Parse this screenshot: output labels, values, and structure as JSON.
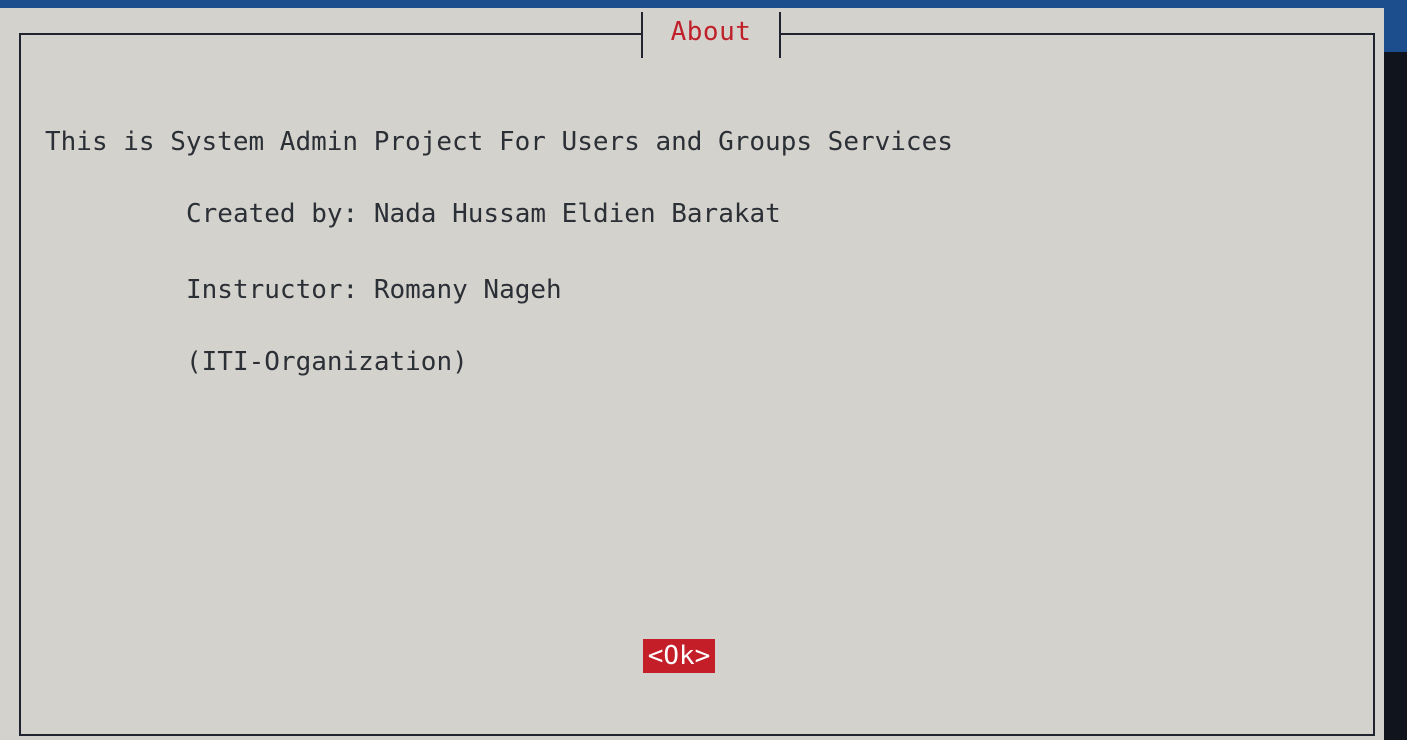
{
  "dialog": {
    "title": "About",
    "message_lines": [
      "This is System Admin Project For Users and Groups Services",
      "Created by: Nada Hussam Eldien Barakat",
      "Instructor: Romany Nageh",
      "(ITI-Organization)"
    ],
    "ok_label": "<Ok>"
  },
  "colors": {
    "dialog_background": "#d4d2cd",
    "title_color": "#c0202a",
    "button_background": "#c41e28",
    "button_text": "#ffffff",
    "frame_color": "#1f2430",
    "terminal_background": "#10141c",
    "top_strip": "#1c4d8c"
  }
}
